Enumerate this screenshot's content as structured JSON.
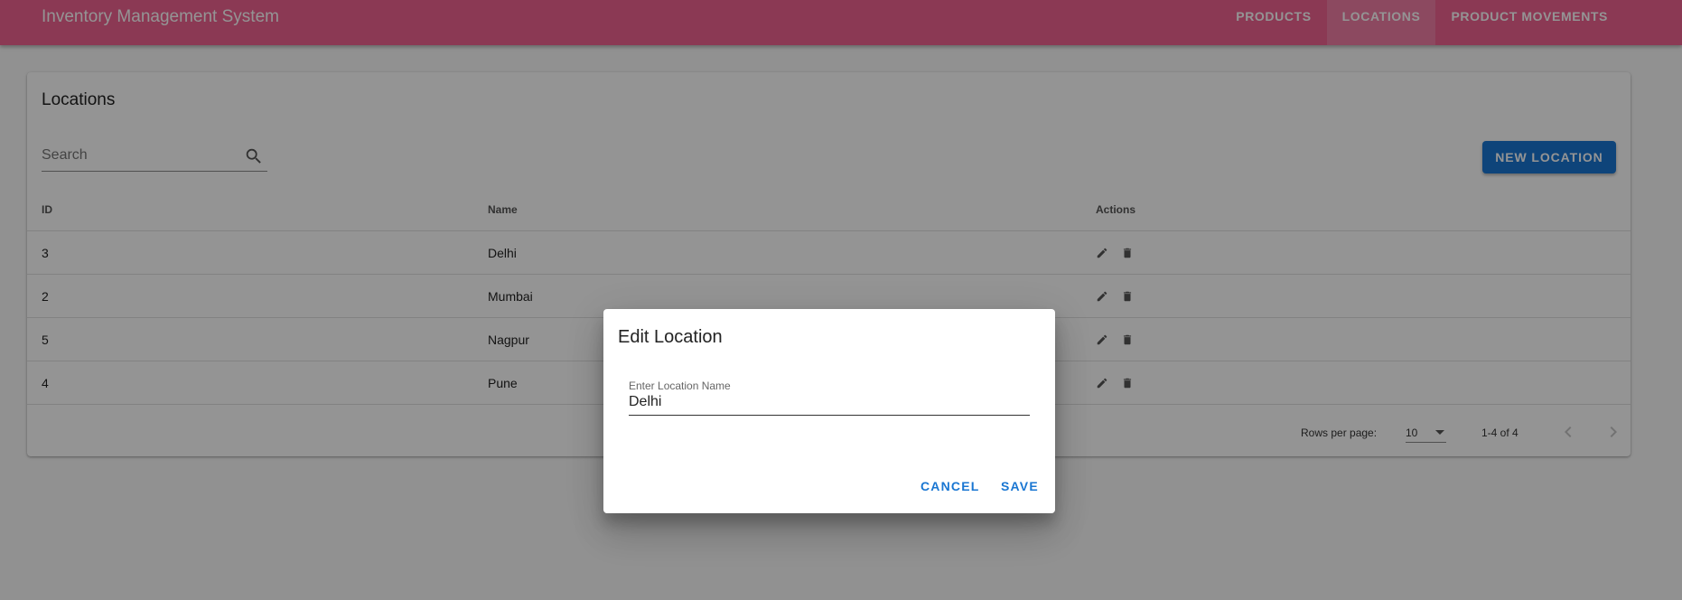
{
  "app": {
    "title": "Inventory Management System"
  },
  "nav": {
    "items": [
      {
        "label": "PRODUCTS"
      },
      {
        "label": "LOCATIONS"
      },
      {
        "label": "PRODUCT MOVEMENTS"
      }
    ],
    "active": "LOCATIONS"
  },
  "page": {
    "title": "Locations",
    "search_placeholder": "Search",
    "new_button_label": "NEW LOCATION"
  },
  "table": {
    "columns": [
      "ID",
      "Name",
      "Actions"
    ],
    "rows": [
      {
        "id": "3",
        "name": "Delhi"
      },
      {
        "id": "2",
        "name": "Mumbai"
      },
      {
        "id": "5",
        "name": "Nagpur"
      },
      {
        "id": "4",
        "name": "Pune"
      }
    ]
  },
  "pagination": {
    "rows_per_page_label": "Rows per page:",
    "rows_per_page_value": "10",
    "range": "1-4 of 4"
  },
  "dialog": {
    "title": "Edit Location",
    "field_label": "Enter Location Name",
    "field_value": "Delhi",
    "cancel_label": "CANCEL",
    "save_label": "SAVE"
  },
  "colors": {
    "appbar": "#f06292",
    "primary": "#1976d2"
  }
}
